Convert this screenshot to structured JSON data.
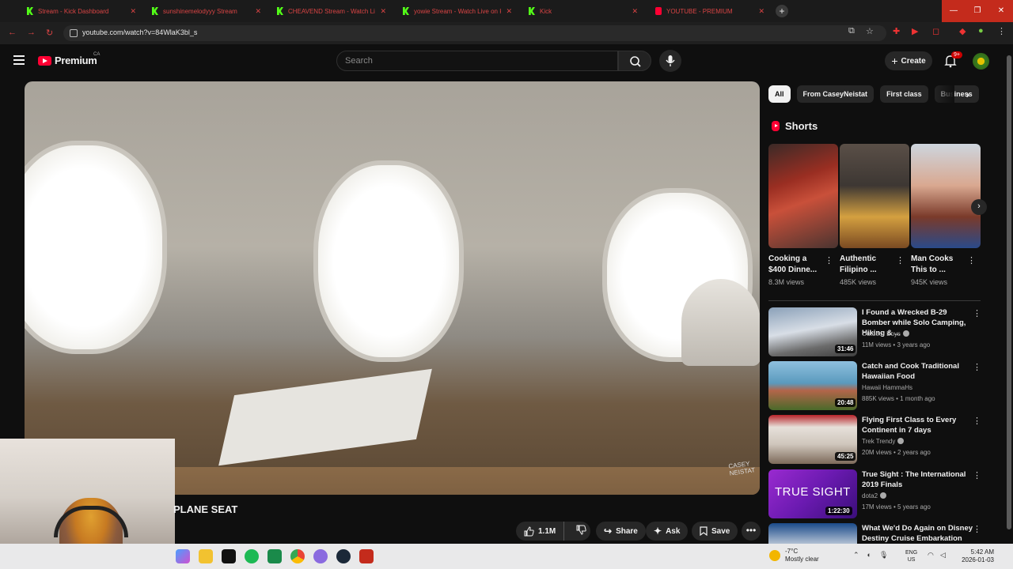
{
  "browser": {
    "tabs": [
      {
        "title": "Stream - Kick Dashboard",
        "icon": "kick-icon"
      },
      {
        "title": "sunshinemelodyyy Stream",
        "icon": "kick-icon"
      },
      {
        "title": "CHEAVEND Stream - Watch Li",
        "icon": "kick-icon"
      },
      {
        "title": "yowie Stream - Watch Live on K",
        "icon": "kick-icon"
      },
      {
        "title": "Kick",
        "icon": "kick-icon"
      },
      {
        "title": "YOUTUBE - PREMIUM",
        "icon": "youtube-icon"
      }
    ],
    "new_tab": "+",
    "url": "youtube.com/watch?v=84WlaK3bl_s",
    "accent": "#c42b1c"
  },
  "header": {
    "logo_text": "Premium",
    "country": "CA",
    "search_placeholder": "Search",
    "create_label": "Create",
    "notification_count": "9+"
  },
  "video": {
    "title": "PLANE SEAT",
    "watermark": "CASEY NEISTAT",
    "likes": "1.1M",
    "share_label": "Share",
    "ask_label": "Ask",
    "save_label": "Save"
  },
  "chips": [
    "All",
    "From CaseyNeistat",
    "First class",
    "Business"
  ],
  "shorts": {
    "title": "Shorts",
    "items": [
      {
        "title": "Cooking a $400 Dinne...",
        "views": "8.3M views"
      },
      {
        "title": "Authentic Filipino ...",
        "views": "485K views"
      },
      {
        "title": "Man Cooks This to ...",
        "views": "945K views"
      }
    ]
  },
  "recommendations": [
    {
      "title": "I Found a Wrecked B-29 Bomber while Solo Camping, Hiking & ...",
      "channel": "Outdoor Boys",
      "verified": true,
      "meta": "11M views • 3 years ago",
      "duration": "31:46"
    },
    {
      "title": "Catch and Cook Traditional Hawaiian Food",
      "channel": "Hawaii HammaHs",
      "verified": false,
      "meta": "885K views • 1 month ago",
      "duration": "20:48"
    },
    {
      "title": "Flying First Class to Every Continent in 7 days",
      "channel": "Trek Trendy",
      "verified": true,
      "meta": "20M views • 2 years ago",
      "duration": "45:25"
    },
    {
      "title": "True Sight : The International 2019 Finals",
      "channel": "dota2",
      "verified": true,
      "meta": "17M views • 5 years ago",
      "duration": "1:22:30"
    },
    {
      "title": "What We'd Do Again on Disney Destiny Cruise Embarkation Day",
      "channel": "",
      "verified": false,
      "meta": "",
      "duration": ""
    }
  ],
  "taskbar": {
    "weather_temp": "-7°C",
    "weather_desc": "Mostly clear",
    "lang_top": "ENG",
    "lang_bottom": "US",
    "time": "5:42 AM",
    "date": "2026-01-03"
  }
}
